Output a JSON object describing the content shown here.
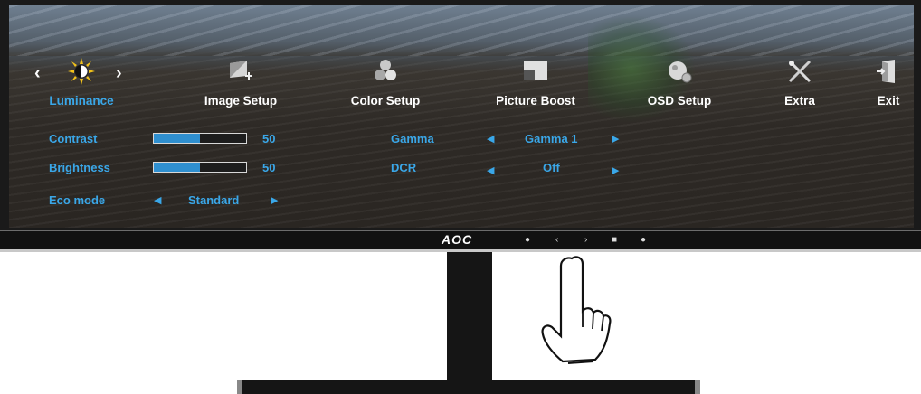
{
  "menu": {
    "items": [
      {
        "label": "Luminance",
        "icon": "sun-icon",
        "active": true
      },
      {
        "label": "Image Setup",
        "icon": "image-setup-icon",
        "active": false
      },
      {
        "label": "Color Setup",
        "icon": "color-setup-icon",
        "active": false
      },
      {
        "label": "Picture Boost",
        "icon": "picture-boost-icon",
        "active": false
      },
      {
        "label": "OSD Setup",
        "icon": "osd-setup-icon",
        "active": false
      },
      {
        "label": "Extra",
        "icon": "tools-icon",
        "active": false
      },
      {
        "label": "Exit",
        "icon": "exit-door-icon",
        "active": false
      }
    ]
  },
  "settings": {
    "contrast": {
      "label": "Contrast",
      "value": "50",
      "level": 0.5
    },
    "brightness": {
      "label": "Brightness",
      "value": "50",
      "level": 0.5
    },
    "eco_mode": {
      "label": "Eco mode",
      "value": "Standard"
    },
    "gamma": {
      "label": "Gamma",
      "value": "Gamma 1"
    },
    "dcr": {
      "label": "DCR",
      "value": "Off"
    }
  },
  "monitor": {
    "brand": "AOC"
  },
  "colors": {
    "accent": "#3aa7e8",
    "active_label": "#3aa7e8",
    "bar_fill": "#2f8fcf",
    "bezel": "#1a1a1a"
  }
}
